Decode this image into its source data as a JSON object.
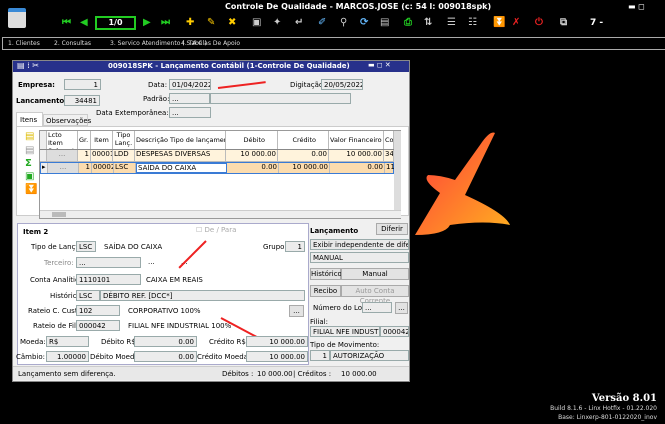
{
  "app": {
    "title": "Controle De Qualidade - MARCOS.JOSE (c: 54 l: 009018spk)",
    "record_nav": "1/0",
    "counter": "7 -"
  },
  "menu": [
    "1. Clientes",
    "2. Consultas",
    "3. Servico Atendimento ( S A C )",
    "4. Tabelas De Apoio"
  ],
  "dialog": {
    "title": "009018SPK - Lançamento Contábil (1-Controle De Qualidade)",
    "empresa_label": "Empresa:",
    "empresa": "1",
    "lancamento_label": "Lancamento:",
    "lancamento": "34481",
    "data_label": "Data:",
    "data": "01/04/2022",
    "digitacao_label": "Digitação:",
    "digitacao": "20/05/2022",
    "padrao_label": "Padrão:",
    "padrao": "...",
    "data_ext_label": "Data Extemporânea:",
    "data_ext": "...",
    "tabs": [
      "Itens",
      "Observações"
    ],
    "grid": {
      "headers": [
        "Lcto Item Subconta",
        "Gr.",
        "Item",
        "Tipo Lanç.",
        "Descrição Tipo de lançamento",
        "Débito",
        "Crédito",
        "Valor Financeiro",
        "Co"
      ],
      "rows": [
        [
          "...",
          "1",
          "00001",
          "LDD",
          "DESPESAS DIVERSAS",
          "10 000.00",
          "0.00",
          "10 000.00",
          "34"
        ],
        [
          "...",
          "1",
          "00002",
          "LSC",
          "SAÍDA DO CAIXA",
          "0.00",
          "10 000.00",
          "0.00",
          "11"
        ]
      ]
    },
    "item": {
      "title": "Item 2",
      "de_para": "De / Para",
      "tipo_label": "Tipo de Lançto:",
      "tipo": "LSC",
      "tipo_desc": "SAÍDA DO CAIXA",
      "grupo_label": "Grupo:",
      "grupo": "1",
      "terceiro_label": "Terceiro:",
      "terceiro": "...",
      "terceiro_a": "...",
      "terceiro_b": "...",
      "conta_label": "Conta Analítica:",
      "conta": "1110101",
      "conta_desc": "CAIXA EM REAIS",
      "historico_label": "Histórico:",
      "historico": "LSC",
      "historico_desc": "DÉBITO REF. [DCC*]",
      "rateio_cc_label": "Rateio C. Custo:",
      "rateio_cc": "102",
      "rateio_cc_desc": "CORPORATIVO 100%",
      "more": "...",
      "rateio_filial_label": "Rateio de Filial:",
      "rateio_filial": "000042",
      "rateio_filial_desc": "FILIAL NFE INDUSTRIAL 100%",
      "moeda_label": "Moeda:",
      "moeda": "R$",
      "debito_rs_label": "Débito R$:",
      "debito_rs": "0.00",
      "credito_rs_label": "Crédito R$:",
      "credito_rs": "10 000.00",
      "cambio_label": "Câmbio:",
      "cambio": "1.00000",
      "debito_moeda_label": "Débito Moeda:",
      "debito_moeda": "0.00",
      "credito_moeda_label": "Crédito Moeda:",
      "credito_moeda": "10 000.00"
    },
    "right": {
      "title": "Lançamento",
      "diferir": "Diferir",
      "exibir": "Exibir independente de diferença",
      "manual_value": "MANUAL",
      "historico": "Histórico",
      "manual": "Manual",
      "recibo": "Recibo",
      "auto_conta": "Auto Conta Corrente",
      "lote_label": "Número do Lote:",
      "lote": "...",
      "lote_btn": "...",
      "filial_label": "Filial:",
      "filial": "FILIAL NFE INDUSTRIAL",
      "filial_code": "000042",
      "tipo_mov_label": "Tipo de Movimento:",
      "tipo_mov_code": "1",
      "tipo_mov": "AUTORIZAÇÃO"
    },
    "status": {
      "message": "Lançamento sem diferença.",
      "debitos_label": "Débitos :",
      "debitos": "10 000.00",
      "creditos_label": "| Créditos :",
      "creditos": "10 000.00"
    }
  },
  "footer": {
    "version": "Versão  8.01",
    "build": "Build 8.1.6 - Linx Hotfix - 01.22.020",
    "base": "Base: Linxerp-801-0122020_inov"
  }
}
